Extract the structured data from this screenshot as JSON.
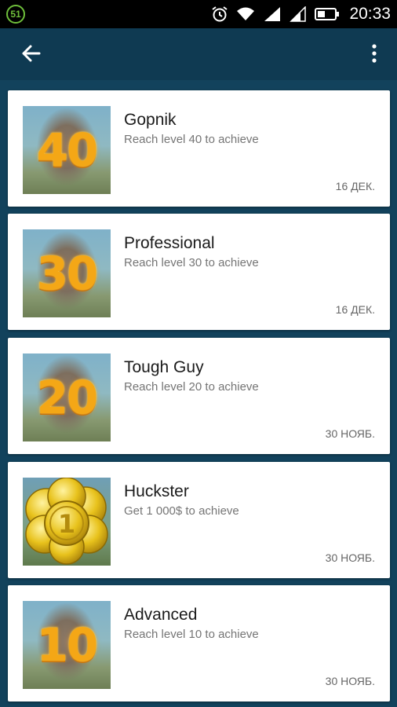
{
  "status_bar": {
    "notification_count": "51",
    "time": "20:33"
  },
  "app_bar": {
    "back_icon": "arrow-left-icon",
    "menu_icon": "more-vertical-icon"
  },
  "achievements": [
    {
      "title": "Gopnik",
      "description": "Reach level 40 to achieve",
      "date": "16 ДЕК.",
      "badge": "40",
      "image": "level-badge"
    },
    {
      "title": "Professional",
      "description": "Reach level 30 to achieve",
      "date": "16 ДЕК.",
      "badge": "30",
      "image": "level-badge"
    },
    {
      "title": "Tough Guy",
      "description": "Reach level 20 to achieve",
      "date": "30 НОЯБ.",
      "badge": "20",
      "image": "level-badge"
    },
    {
      "title": "Huckster",
      "description": "Get 1 000$ to achieve",
      "date": "30 НОЯБ.",
      "badge": "1",
      "image": "gold-coins"
    },
    {
      "title": "Advanced",
      "description": "Reach level 10 to achieve",
      "date": "30 НОЯБ.",
      "badge": "10",
      "image": "level-badge"
    }
  ],
  "colors": {
    "app_bar": "#0f3a52",
    "status_bar": "#000000",
    "card_bg": "#ffffff",
    "badge_orange": "#f4a716"
  }
}
